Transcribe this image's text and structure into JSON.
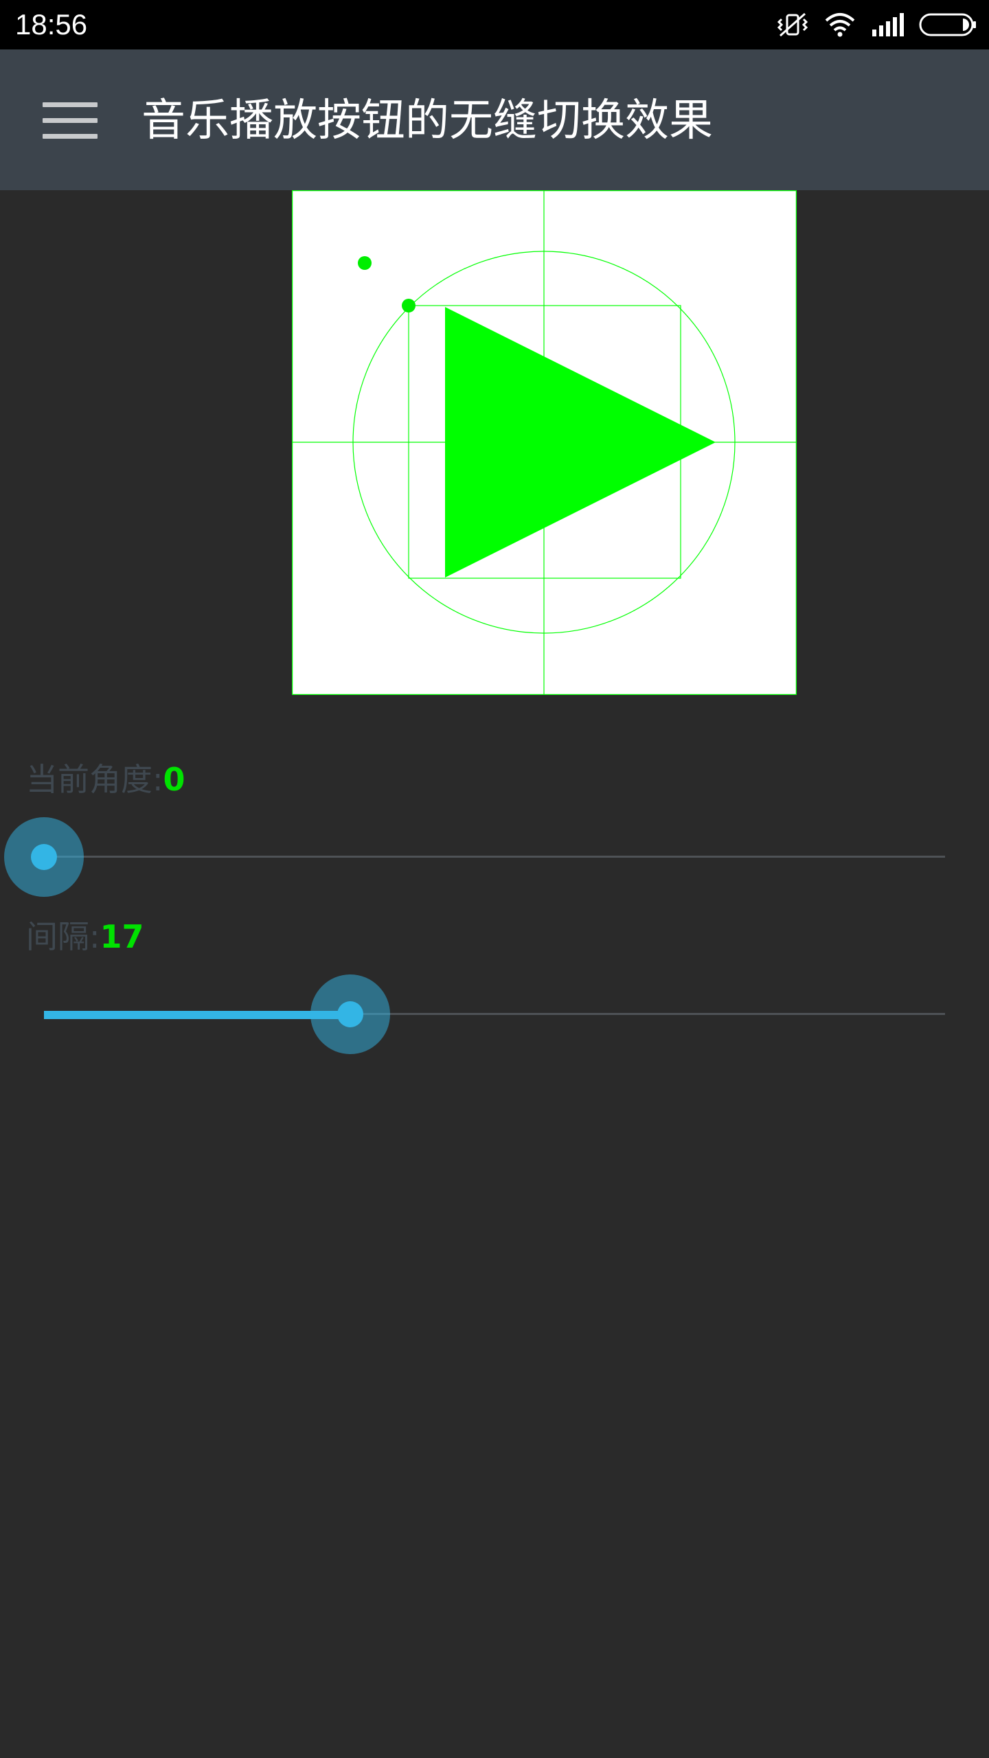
{
  "status_bar": {
    "time": "18:56",
    "icons": [
      "vibrate-off-icon",
      "wifi-icon",
      "signal-icon",
      "battery-icon"
    ]
  },
  "app_bar": {
    "menu_icon": "hamburger-menu-icon",
    "title": "音乐播放按钮的无缝切换效果"
  },
  "canvas": {
    "background": "#ffffff",
    "guide_color": "#00ff00",
    "shape": "play-triangle"
  },
  "angle_control": {
    "label": "当前角度:",
    "value": "0",
    "fraction": 0.0
  },
  "gap_control": {
    "label": "间隔:",
    "value": "17",
    "fraction": 0.34
  },
  "colors": {
    "status_bar_bg": "#000000",
    "app_bar_bg": "#3c444c",
    "page_bg": "#2a2a2a",
    "accent": "#33b5e5",
    "value_green": "#00e200",
    "label_gray": "#3f4850"
  }
}
